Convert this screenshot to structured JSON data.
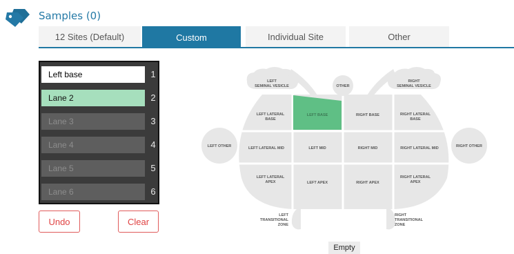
{
  "header": {
    "title": "Samples (0)",
    "icon": "tags-icon"
  },
  "tabs": [
    {
      "label": "12 Sites (Default)",
      "active": false
    },
    {
      "label": "Custom",
      "active": true
    },
    {
      "label": "Individual Site",
      "active": false
    },
    {
      "label": "Other",
      "active": false
    }
  ],
  "lanes": [
    {
      "label": "Left base",
      "number": "1",
      "state": "white"
    },
    {
      "label": "Lane 2",
      "number": "2",
      "state": "green"
    },
    {
      "label": "Lane 3",
      "number": "3",
      "state": "grey"
    },
    {
      "label": "Lane 4",
      "number": "4",
      "state": "grey"
    },
    {
      "label": "Lane 5",
      "number": "5",
      "state": "grey"
    },
    {
      "label": "Lane 6",
      "number": "6",
      "state": "grey"
    }
  ],
  "actions": {
    "undo_label": "Undo",
    "clear_label": "Clear"
  },
  "diagram": {
    "left_seminal_vesicle": [
      "LEFT",
      "SEMINAL VESICLE"
    ],
    "right_seminal_vesicle": [
      "RIGHT",
      "SEMINAL VESICLE"
    ],
    "other": "OTHER",
    "left_other": "LEFT OTHER",
    "right_other": "RIGHT OTHER",
    "left_lateral_base": [
      "LEFT LATERAL",
      "BASE"
    ],
    "left_base": "LEFT BASE",
    "right_base": "RIGHT BASE",
    "right_lateral_base": [
      "RIGHT LATERAL",
      "BASE"
    ],
    "left_lateral_mid": "LEFT LATERAL MID",
    "left_mid": "LEFT MID",
    "right_mid": "RIGHT MID",
    "right_lateral_mid": "RIGHT LATERAL MID",
    "left_lateral_apex": [
      "LEFT LATERAL",
      "APEX"
    ],
    "left_apex": "LEFT APEX",
    "right_apex": "RIGHT APEX",
    "right_lateral_apex": [
      "RIGHT LATERAL",
      "APEX"
    ],
    "left_transitional_zone": [
      "LEFT",
      "TRANSITIONAL",
      "ZONE"
    ],
    "right_transitional_zone": [
      "RIGHT",
      "TRANSITIONAL",
      "ZONE"
    ],
    "selected_region": "left_base"
  },
  "status": {
    "empty_label": "Empty"
  },
  "colors": {
    "accent": "#1f78a3",
    "selected": "#5fbf85",
    "lane_green": "#a6dfbd",
    "danger": "#e04343"
  }
}
